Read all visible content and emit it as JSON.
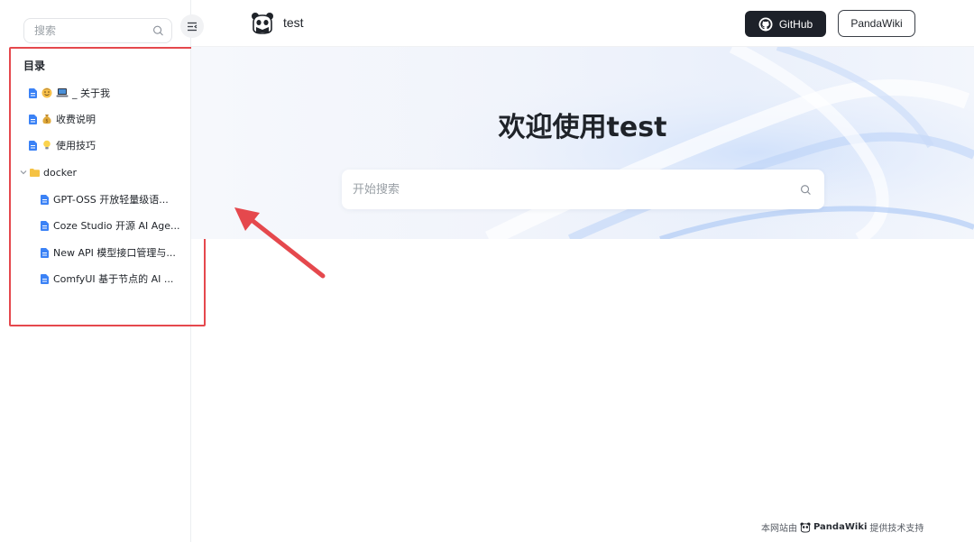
{
  "sidebar": {
    "search_placeholder": "搜索",
    "toc_title": "目录",
    "items": [
      {
        "label": "_ 关于我",
        "icon": "doc-icon",
        "emoji": "face-laptop-emoji"
      },
      {
        "label": "收费说明",
        "icon": "doc-icon",
        "emoji": "money-bag-emoji"
      },
      {
        "label": "使用技巧",
        "icon": "doc-icon",
        "emoji": "light-bulb-emoji"
      }
    ],
    "folder": {
      "label": "docker",
      "icon": "folder-icon",
      "expanded": true,
      "children": [
        {
          "label": "GPT-OSS 开放轻量级语..."
        },
        {
          "label": "Coze Studio 开源 AI Age..."
        },
        {
          "label": "New API 模型接口管理与..."
        },
        {
          "label": "ComfyUI 基于节点的 AI ..."
        }
      ]
    }
  },
  "header": {
    "site_name": "test",
    "github_label": "GitHub",
    "pandawiki_label": "PandaWiki"
  },
  "hero": {
    "title": "欢迎使用test",
    "search_placeholder": "开始搜索"
  },
  "footer": {
    "prefix": "本网站由",
    "brand": "PandaWiki",
    "suffix": "提供技术支持"
  },
  "colors": {
    "annotation_red": "#e5484d",
    "github_button_bg": "#1d2129",
    "doc_icon_blue": "#3b82f6",
    "folder_yellow": "#f5c243"
  }
}
